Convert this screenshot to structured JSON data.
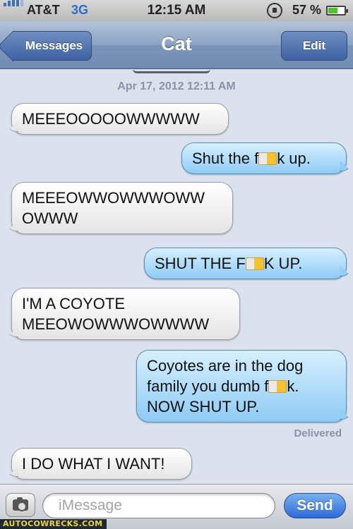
{
  "status_bar": {
    "carrier": "AT&T",
    "network": "3G",
    "time": "12:15 AM",
    "battery_percent": "57 %",
    "battery_level": 0.57,
    "icons": [
      "signal-bars-icon",
      "rotation-lock-icon",
      "battery-icon"
    ]
  },
  "nav": {
    "back_label": "Messages",
    "title": "Cat",
    "edit_label": "Edit"
  },
  "thread": {
    "timestamp": "Apr 17, 2012 12:11 AM",
    "messages": [
      {
        "direction": "incoming",
        "text": "MEEEOOOOOWWWWW"
      },
      {
        "direction": "outgoing",
        "text_before": "Shut the f",
        "text_after": "k up."
      },
      {
        "direction": "incoming",
        "text": "MEEEOWWOWWWOWW OWWW"
      },
      {
        "direction": "outgoing",
        "text_before": "SHUT THE F",
        "text_after": "K UP."
      },
      {
        "direction": "incoming",
        "text": "I'M A COYOTE MEEOWOWWWOWWWW"
      },
      {
        "direction": "outgoing",
        "text_before": "Coyotes are in the dog family you dumb f",
        "text_after": "k. NOW SHUT UP."
      },
      {
        "direction": "incoming",
        "text": "I DO WHAT I WANT!"
      }
    ],
    "delivered_label": "Delivered"
  },
  "input_bar": {
    "placeholder": "iMessage",
    "send_label": "Send"
  },
  "watermark": "AUTOCOWRECKS.COM",
  "colors": {
    "nav_bar": "#7a95b8",
    "outgoing_bubble": "#8fcbf5",
    "incoming_bubble": "#ffffff",
    "send_button": "#2c6bd6",
    "background": "#dbe2ed"
  }
}
